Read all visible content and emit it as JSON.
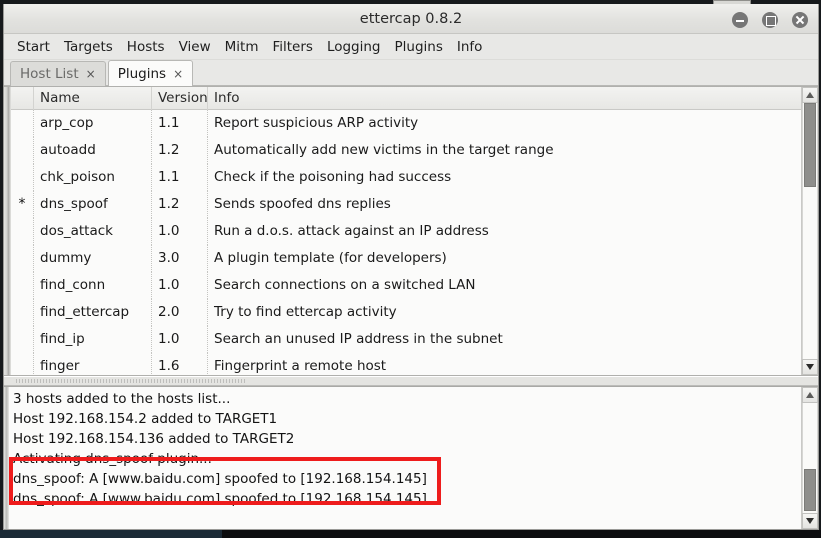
{
  "window": {
    "title": "ettercap 0.8.2",
    "controls": [
      {
        "name": "minimize",
        "glyph": "–"
      },
      {
        "name": "maximize",
        "glyph": "□"
      },
      {
        "name": "close",
        "glyph": "×"
      }
    ]
  },
  "menubar": {
    "items": [
      "Start",
      "Targets",
      "Hosts",
      "View",
      "Mitm",
      "Filters",
      "Logging",
      "Plugins",
      "Info"
    ]
  },
  "tabs": [
    {
      "label": "Host List",
      "close": "×",
      "active": false
    },
    {
      "label": "Plugins",
      "close": "×",
      "active": true
    }
  ],
  "plugin_table": {
    "columns": {
      "mark": "",
      "name": "Name",
      "version": "Version",
      "info": "Info"
    },
    "rows": [
      {
        "mark": "",
        "name": "arp_cop",
        "version": "1.1",
        "info": "Report suspicious ARP activity"
      },
      {
        "mark": "",
        "name": "autoadd",
        "version": "1.2",
        "info": "Automatically add new victims in the target range"
      },
      {
        "mark": "",
        "name": "chk_poison",
        "version": "1.1",
        "info": "Check if the poisoning had success"
      },
      {
        "mark": "*",
        "name": "dns_spoof",
        "version": "1.2",
        "info": "Sends spoofed dns replies"
      },
      {
        "mark": "",
        "name": "dos_attack",
        "version": "1.0",
        "info": "Run a d.o.s. attack against an IP address"
      },
      {
        "mark": "",
        "name": "dummy",
        "version": "3.0",
        "info": "A plugin template (for developers)"
      },
      {
        "mark": "",
        "name": "find_conn",
        "version": "1.0",
        "info": "Search connections on a switched LAN"
      },
      {
        "mark": "",
        "name": "find_ettercap",
        "version": "2.0",
        "info": "Try to find ettercap activity"
      },
      {
        "mark": "",
        "name": "find_ip",
        "version": "1.0",
        "info": "Search an unused IP address in the subnet"
      },
      {
        "mark": "",
        "name": "finger",
        "version": "1.6",
        "info": "Fingerprint a remote host"
      }
    ],
    "scrollbar": {
      "thumb_top_pct": 0,
      "thumb_height_pct": 33
    }
  },
  "log": {
    "lines": [
      {
        "text": "3 hosts added to the hosts list...",
        "highlighted": false
      },
      {
        "text": "Host 192.168.154.2 added to TARGET1",
        "highlighted": false
      },
      {
        "text": "Host 192.168.154.136 added to TARGET2",
        "highlighted": false
      },
      {
        "text": "Activating dns_spoof plugin...",
        "highlighted": false
      },
      {
        "text": "dns_spoof: A [www.baidu.com] spoofed to [192.168.154.145]",
        "highlighted": true
      },
      {
        "text": "dns_spoof: A [www.baidu.com] spoofed to [192.168.154.145]",
        "highlighted": true
      }
    ],
    "highlight_color": "#ee1c1c",
    "scrollbar": {
      "thumb_top_pct": 60,
      "thumb_height_pct": 38
    }
  }
}
